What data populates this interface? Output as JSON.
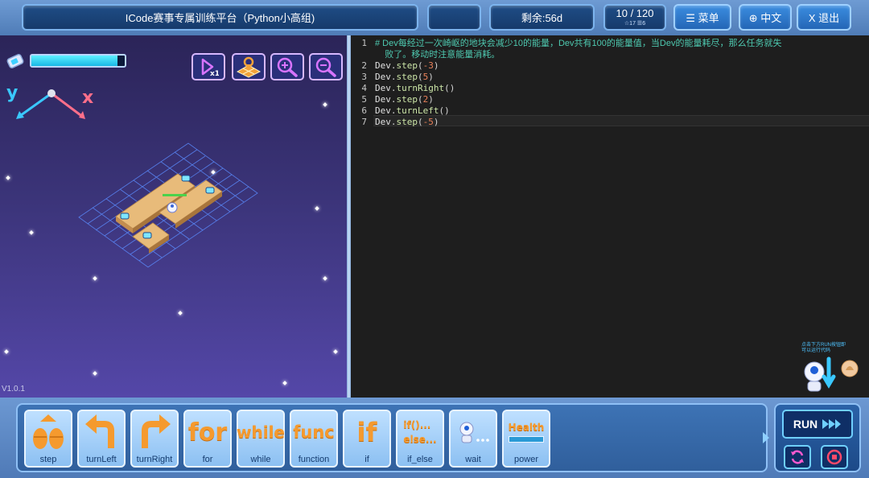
{
  "header": {
    "title": "ICode赛事专属训练平台（Python小高组)",
    "remaining": "剩余:56d",
    "progress_main": "10 / 120",
    "progress_sub": "☆17   ☰6",
    "menu_label": "☰ 菜单",
    "lang_label": "⊕ 中文",
    "exit_label": "X 退出"
  },
  "game": {
    "energy_fraction": 0.92,
    "axis_y": "y",
    "axis_x": "x",
    "version": "V1.0.1",
    "tools": [
      "speed-icon",
      "map-view-icon",
      "zoom-in-icon",
      "zoom-out-icon"
    ]
  },
  "editor": {
    "lines": [
      {
        "n": "1",
        "comment": "# Dev每经过一次崎岖的地块会减少10的能量，Dev共有100的能量值，当Dev的能量耗尽，那么任务就失"
      },
      {
        "n": "",
        "comment": "    败了。移动时注意能量消耗。"
      },
      {
        "n": "2",
        "obj": "Dev",
        "fn": "step",
        "arg": "-3"
      },
      {
        "n": "3",
        "obj": "Dev",
        "fn": "step",
        "arg": "5"
      },
      {
        "n": "4",
        "obj": "Dev",
        "fn": "turnRight",
        "arg": ""
      },
      {
        "n": "5",
        "obj": "Dev",
        "fn": "step",
        "arg": "2"
      },
      {
        "n": "6",
        "obj": "Dev",
        "fn": "turnLeft",
        "arg": ""
      },
      {
        "n": "7",
        "obj": "Dev",
        "fn": "step",
        "arg": "-5"
      }
    ],
    "hint": "点击下方RUN按钮即可以运行代码"
  },
  "palette": {
    "blocks": [
      {
        "id": "step",
        "label": "step",
        "icon": "step-icon"
      },
      {
        "id": "turnLeft",
        "label": "turnLeft",
        "icon": "turn-left-icon"
      },
      {
        "id": "turnRight",
        "label": "turnRight",
        "icon": "turn-right-icon"
      },
      {
        "id": "for",
        "label": "for",
        "icon": "for-icon",
        "text": "for"
      },
      {
        "id": "while",
        "label": "while",
        "icon": "while-icon",
        "text": "while"
      },
      {
        "id": "function",
        "label": "function",
        "icon": "func-icon",
        "text": "func"
      },
      {
        "id": "if",
        "label": "if",
        "icon": "if-icon",
        "text": "if"
      },
      {
        "id": "if_else",
        "label": "if_else",
        "icon": "if-else-icon",
        "text": "if()...\nelse..."
      },
      {
        "id": "wait",
        "label": "wait",
        "icon": "wait-icon"
      },
      {
        "id": "power",
        "label": "power",
        "icon": "health-icon",
        "text": "Health"
      }
    ],
    "run_label": "RUN"
  },
  "colors": {
    "accent": "#2d7fd6",
    "energy": "#19b9e6",
    "comment": "#4ec9b0",
    "number": "#e8815a",
    "block_keyword": "#f59a2e"
  }
}
